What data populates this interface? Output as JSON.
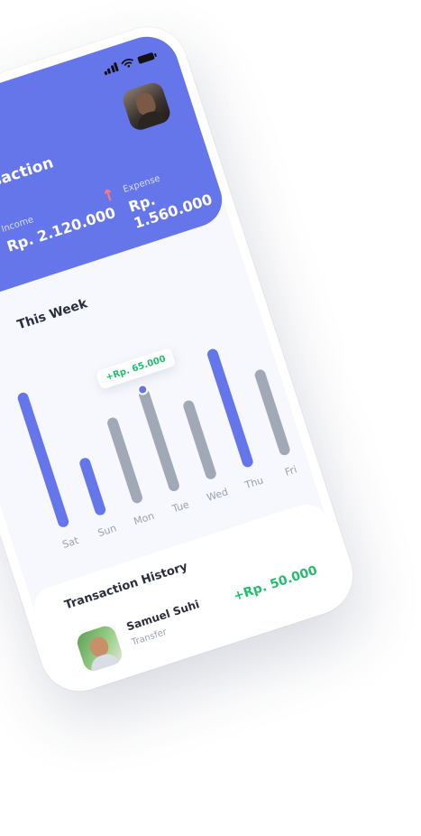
{
  "header": {
    "title": "Transaction",
    "income_label": "Income",
    "income_value": "Rp. 2.120.000",
    "expense_label": "Expense",
    "expense_value": "Rp. 1.560.000",
    "expense_arrow_icon": "arrow-up-icon",
    "accent": "#6575ea",
    "expense_arrow_color": "#ff7a7a"
  },
  "week": {
    "title": "This Week"
  },
  "chart_data": {
    "type": "bar",
    "categories": [
      "Sat",
      "Sun",
      "Mon",
      "Tue",
      "Wed",
      "Thu",
      "Fri"
    ],
    "values": [
      0.82,
      0.35,
      0.52,
      0.62,
      0.48,
      0.72,
      0.52
    ],
    "highlight": [
      true,
      true,
      false,
      false,
      false,
      true,
      false
    ],
    "highlight_color": "#6575ea",
    "muted_color": "#a2a9b6",
    "tooltip": {
      "category": "Tue",
      "label": "+Rp. 65.000",
      "color": "#1fbf6b"
    }
  },
  "history": {
    "title": "Transaction History",
    "items": [
      {
        "name": "Samuel Suhi",
        "type": "Transfer",
        "amount": "+Rp. 50.000",
        "amount_color": "#1fbf6b"
      }
    ]
  }
}
